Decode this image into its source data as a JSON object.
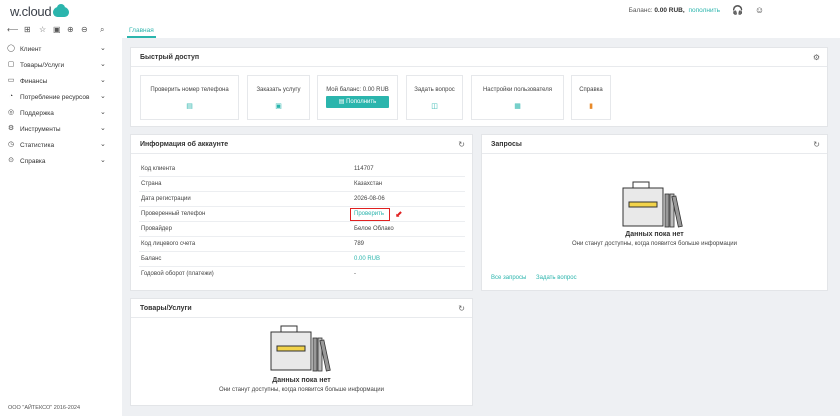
{
  "header": {
    "logo_text": "w.cloud",
    "balance_label": "Баланс:",
    "balance_value": "0.00 RUB,",
    "topup_link": "пополнить"
  },
  "tabs": [
    {
      "label": "Главная"
    }
  ],
  "sidebar": {
    "items": [
      {
        "label": "Клиент",
        "icon": "user-icon"
      },
      {
        "label": "Товары/Услуги",
        "icon": "box-icon"
      },
      {
        "label": "Финансы",
        "icon": "wallet-icon"
      },
      {
        "label": "Потребление ресурсов",
        "icon": "pie-icon"
      },
      {
        "label": "Поддержка",
        "icon": "lifebuoy-icon"
      },
      {
        "label": "Инструменты",
        "icon": "gear-icon"
      },
      {
        "label": "Статистика",
        "icon": "chart-icon"
      },
      {
        "label": "Справка",
        "icon": "help-icon"
      }
    ],
    "copyright": "ООО \"АЙТЕКСО\" 2016-2024"
  },
  "quick_access": {
    "title": "Быстрый доступ",
    "tiles": [
      {
        "label": "Проверить номер телефона"
      },
      {
        "label": "Заказать услугу"
      },
      {
        "label": "Мой баланс: 0.00 RUB",
        "button": "Пополнить"
      },
      {
        "label": "Задать вопрос"
      },
      {
        "label": "Настройки пользователя"
      },
      {
        "label": "Справка"
      }
    ]
  },
  "account_info": {
    "title": "Информация об аккаунте",
    "rows": [
      {
        "key": "Код клиента",
        "value": "114707"
      },
      {
        "key": "Страна",
        "value": "Казахстан"
      },
      {
        "key": "Дата регистрации",
        "value": "2026-08-06"
      },
      {
        "key": "Проверенный телефон",
        "value": "Проверить"
      },
      {
        "key": "Провайдер",
        "value": "Белое Облако"
      },
      {
        "key": "Код лицевого счета",
        "value": "789"
      },
      {
        "key": "Баланс",
        "value": "0.00 RUB"
      },
      {
        "key": "Годовой оборот (платежи)",
        "value": "-"
      }
    ]
  },
  "requests": {
    "title": "Запросы",
    "empty_title": "Данных пока нет",
    "empty_sub": "Они станут доступны, когда появится больше информации",
    "link_all": "Все запросы",
    "link_ask": "Задать вопрос"
  },
  "products": {
    "title": "Товары/Услуги",
    "empty_title": "Данных пока нет",
    "empty_sub": "Они станут доступны, когда появится больше информации"
  },
  "colors": {
    "accent": "#2bb5ad",
    "highlight": "#e02020"
  }
}
